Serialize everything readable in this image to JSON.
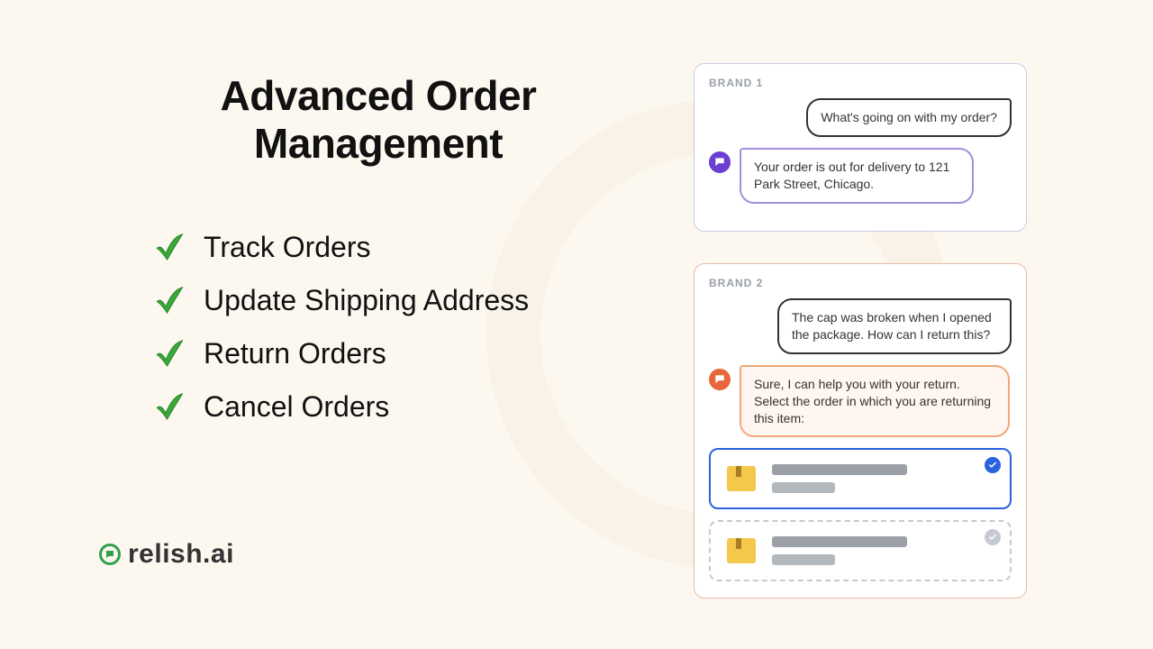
{
  "title_line1": "Advanced Order",
  "title_line2": "Management",
  "features": [
    {
      "label": "Track Orders"
    },
    {
      "label": "Update Shipping Address"
    },
    {
      "label": "Return Orders"
    },
    {
      "label": "Cancel Orders"
    }
  ],
  "brand": {
    "name": "relish",
    "suffix": ".ai"
  },
  "chats": {
    "brand1": {
      "label": "BRAND 1",
      "user_msg": "What's going on with my order?",
      "bot_msg": "Your order is out for delivery to 121 Park Street, Chicago.",
      "colors": {
        "accent": "#6b3fd1"
      }
    },
    "brand2": {
      "label": "BRAND 2",
      "user_msg": "The cap was broken when I opened the package. How can I return this?",
      "bot_msg": "Sure, I can help you with your return. Select the order in which you are returning this item:",
      "colors": {
        "accent": "#e7673a"
      }
    }
  }
}
